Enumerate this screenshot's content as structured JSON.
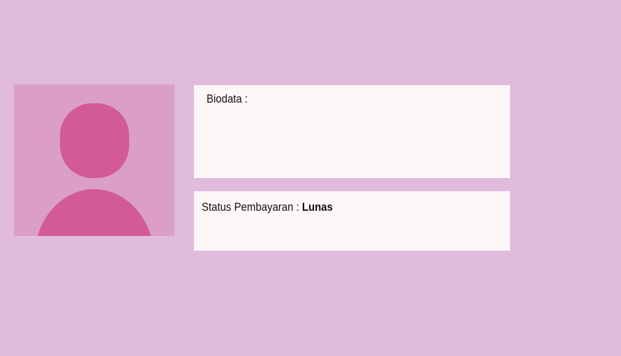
{
  "profile": {
    "avatar_icon": "user-placeholder-icon",
    "colors": {
      "page_background": "#e0bbdb",
      "avatar_background": "#da9ec8",
      "avatar_figure": "#d25a98",
      "card_background": "#fdf7f7"
    }
  },
  "biodata": {
    "label": "Biodata :"
  },
  "payment": {
    "label": "Status Pembayaran : ",
    "value": "Lunas"
  }
}
